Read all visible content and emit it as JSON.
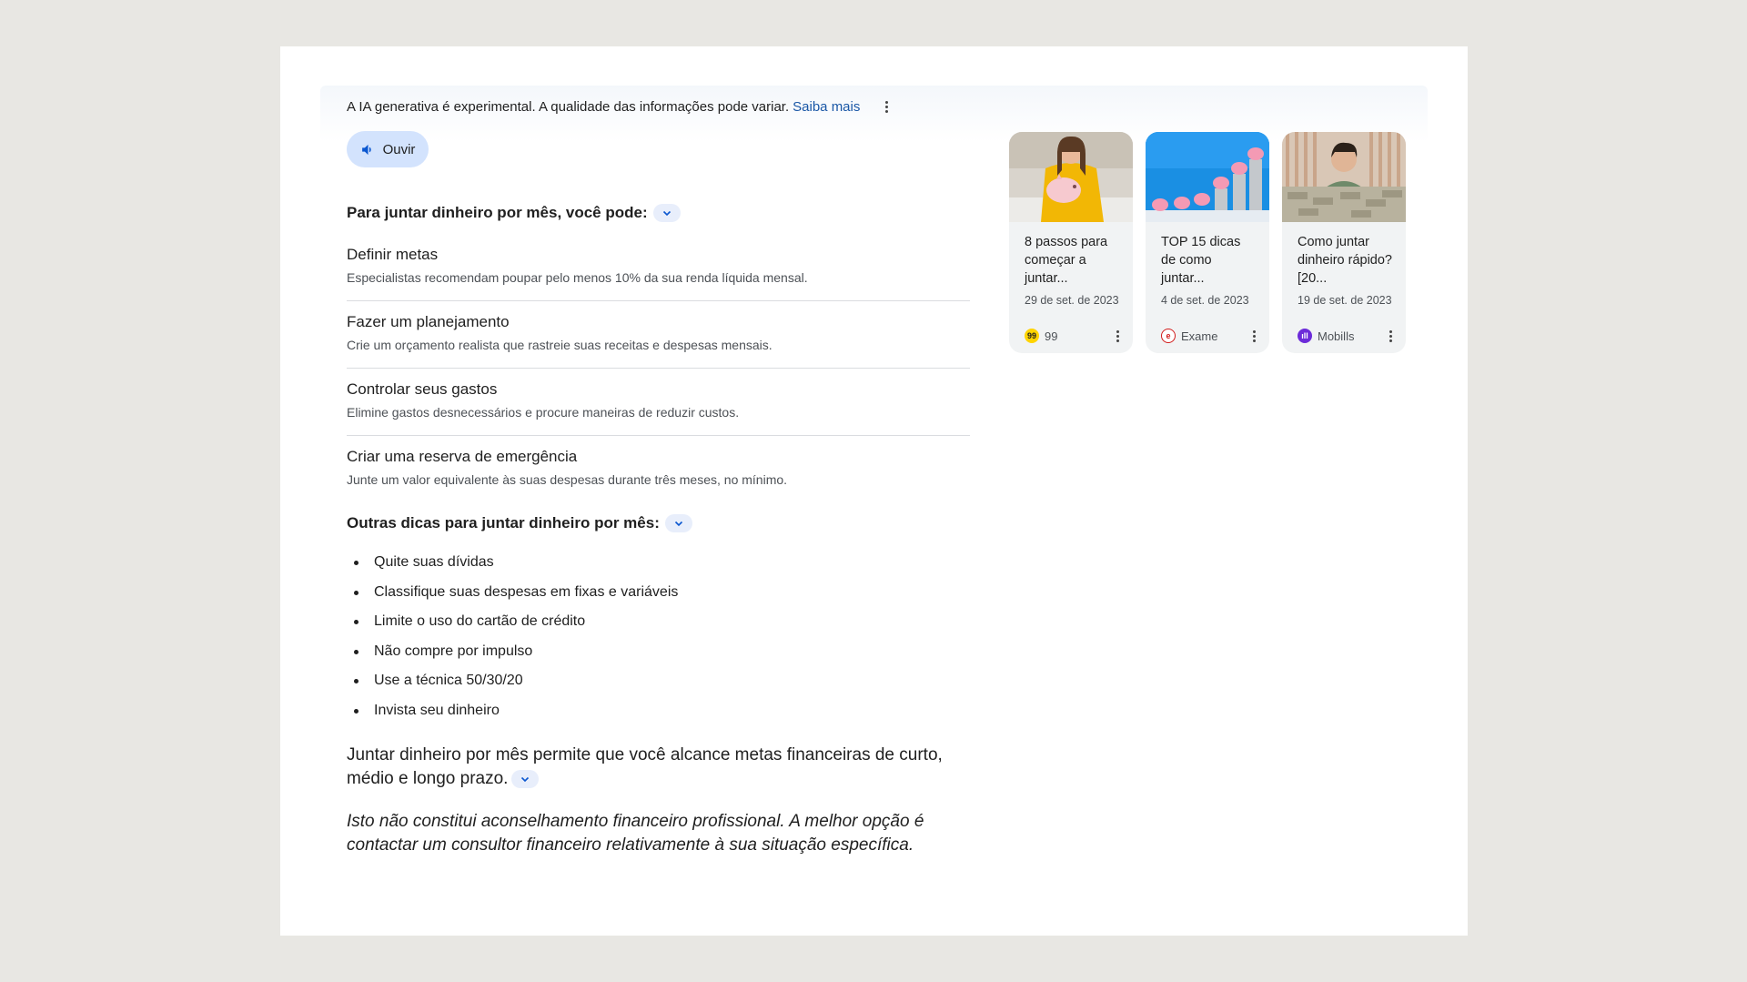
{
  "ai_notice": {
    "text": "A IA generativa é experimental. A qualidade das informações pode variar.",
    "learn_more": "Saiba mais"
  },
  "listen_button": {
    "label": "Ouvir"
  },
  "section1": {
    "heading": "Para juntar dinheiro por mês, você pode:",
    "steps": [
      {
        "title": "Definir metas",
        "desc": "Especialistas recomendam poupar pelo menos 10% da sua renda líquida mensal."
      },
      {
        "title": "Fazer um planejamento",
        "desc": "Crie um orçamento realista que rastreie suas receitas e despesas mensais."
      },
      {
        "title": "Controlar seus gastos",
        "desc": "Elimine gastos desnecessários e procure maneiras de reduzir custos."
      },
      {
        "title": "Criar uma reserva de emergência",
        "desc": "Junte um valor equivalente às suas despesas durante três meses, no mínimo."
      }
    ]
  },
  "section2": {
    "heading": "Outras dicas para juntar dinheiro por mês:",
    "tips": [
      "Quite suas dívidas",
      "Classifique suas despesas em fixas e variáveis",
      "Limite o uso do cartão de crédito",
      "Não compre por impulso",
      "Use a técnica 50/30/20",
      "Invista seu dinheiro"
    ]
  },
  "summary": "Juntar dinheiro por mês permite que você alcance metas financeiras de curto, médio e longo prazo.",
  "disclaimer": "Isto não constitui aconselhamento financeiro profissional. A melhor opção é contactar um consultor financeiro relativamente à sua situação específica.",
  "sources": [
    {
      "title": "8 passos para começar a juntar...",
      "date": "29 de set. de 2023",
      "source": "99",
      "logo_text": "99",
      "logo_bg": "#ffd400",
      "logo_fg": "#1f1f1f"
    },
    {
      "title": "TOP 15 dicas de como juntar...",
      "date": "4 de set. de 2023",
      "source": "Exame",
      "logo_text": "e",
      "logo_bg": "#ffffff",
      "logo_fg": "#d21b1b"
    },
    {
      "title": "Como juntar dinheiro rápido? [20...",
      "date": "19 de set. de 2023",
      "source": "Mobills",
      "logo_text": "ıll",
      "logo_bg": "#6c2bd9",
      "logo_fg": "#ffffff"
    }
  ],
  "colors": {
    "accent_link": "#1a57a6",
    "chip_bg": "#d3e3fd",
    "card_bg": "#f1f3f4"
  }
}
